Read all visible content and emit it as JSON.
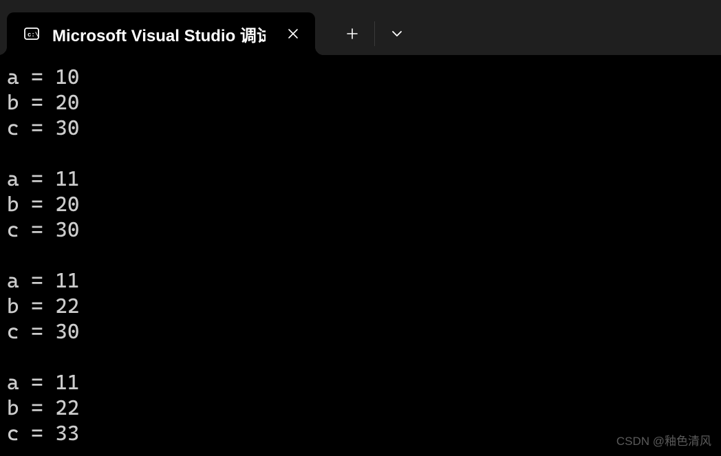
{
  "tab": {
    "title": "Microsoft Visual Studio 调试控",
    "icon_name": "terminal-icon"
  },
  "console": {
    "lines": [
      "a = 10",
      "b = 20",
      "c = 30",
      "",
      "a = 11",
      "b = 20",
      "c = 30",
      "",
      "a = 11",
      "b = 22",
      "c = 30",
      "",
      "a = 11",
      "b = 22",
      "c = 33"
    ]
  },
  "watermark": "CSDN @釉色清风"
}
